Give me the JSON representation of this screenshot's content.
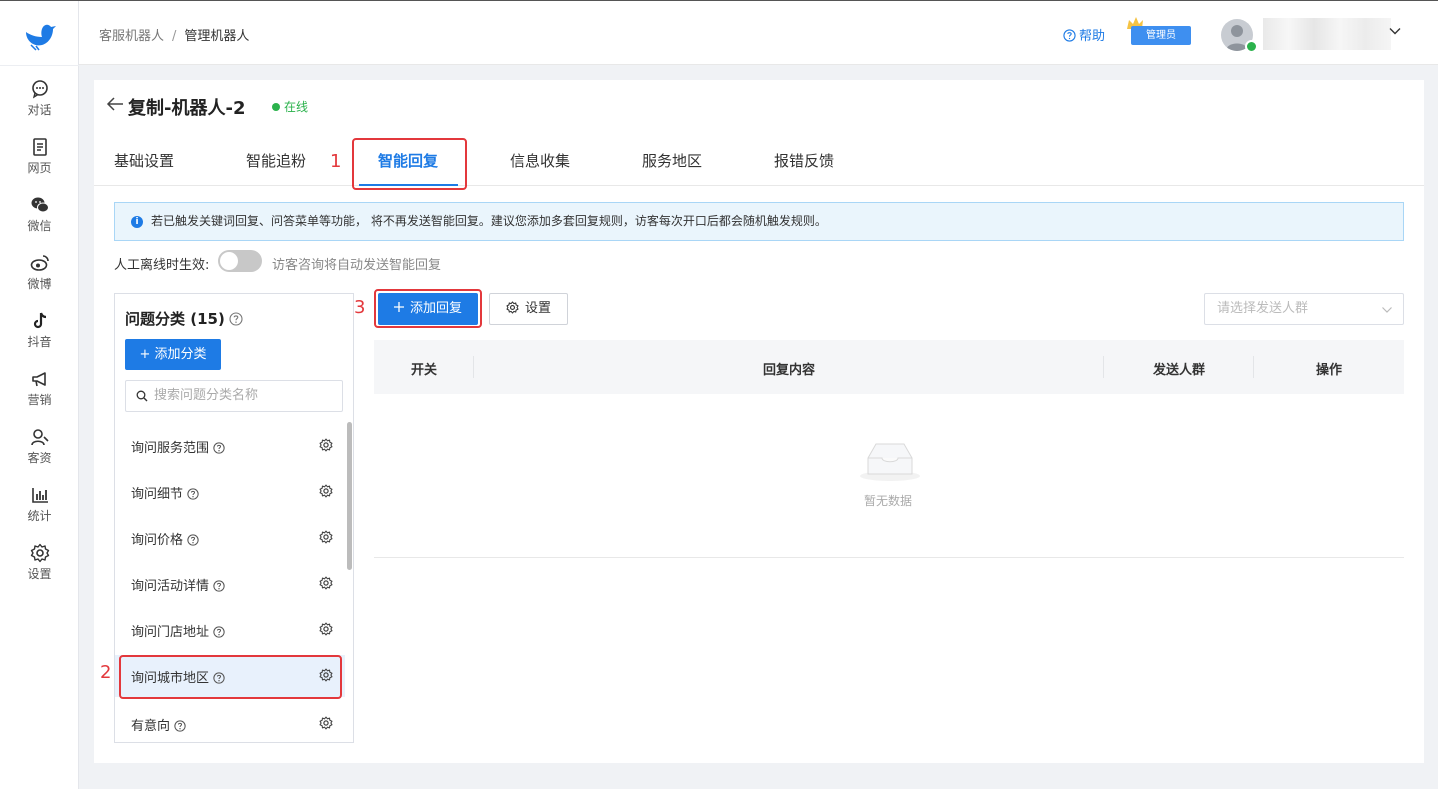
{
  "sidebar": {
    "items": [
      {
        "label": "对话",
        "icon": "chat-icon"
      },
      {
        "label": "网页",
        "icon": "webpage-icon"
      },
      {
        "label": "微信",
        "icon": "wechat-icon"
      },
      {
        "label": "微博",
        "icon": "weibo-icon"
      },
      {
        "label": "抖音",
        "icon": "tiktok-icon"
      },
      {
        "label": "营销",
        "icon": "megaphone-icon"
      },
      {
        "label": "客资",
        "icon": "customer-icon"
      },
      {
        "label": "统计",
        "icon": "chart-icon"
      },
      {
        "label": "设置",
        "icon": "gear-icon"
      }
    ]
  },
  "header": {
    "breadcrumb": {
      "parent": "客服机器人",
      "separator": "/",
      "current": "管理机器人"
    },
    "help_label": "帮助",
    "admin_badge": "管理员"
  },
  "bot": {
    "name": "复制-机器人-2",
    "status": "在线"
  },
  "tabs": [
    {
      "label": "基础设置",
      "active": false
    },
    {
      "label": "智能追粉",
      "active": false
    },
    {
      "label": "智能回复",
      "active": true
    },
    {
      "label": "信息收集",
      "active": false
    },
    {
      "label": "服务地区",
      "active": false
    },
    {
      "label": "报错反馈",
      "active": false
    }
  ],
  "annotations": [
    "1",
    "2",
    "3"
  ],
  "notice": "若已触发关键词回复、问答菜单等功能， 将不再发送智能回复。建议您添加多套回复规则，访客每次开口后都会随机触发规则。",
  "offline": {
    "label": "人工离线时生效:",
    "enabled": false,
    "tip": "访客咨询将自动发送智能回复"
  },
  "categories": {
    "title": "问题分类 (15)",
    "add_label": "+ 添加分类",
    "search_placeholder": "搜索问题分类名称",
    "items": [
      {
        "label": "询问服务范围"
      },
      {
        "label": "询问细节"
      },
      {
        "label": "询问价格"
      },
      {
        "label": "询问活动详情"
      },
      {
        "label": "询问门店地址"
      },
      {
        "label": "询问城市地区"
      },
      {
        "label": "有意向"
      }
    ]
  },
  "replies": {
    "add_label": "添加回复",
    "settings_label": "设置",
    "group_placeholder": "请选择发送人群",
    "columns": [
      "开关",
      "回复内容",
      "发送人群",
      "操作"
    ],
    "empty_text": "暂无数据"
  },
  "colors": {
    "accent": "#1e7be5",
    "online": "#2bb24c",
    "highlight": "#e3383c"
  }
}
